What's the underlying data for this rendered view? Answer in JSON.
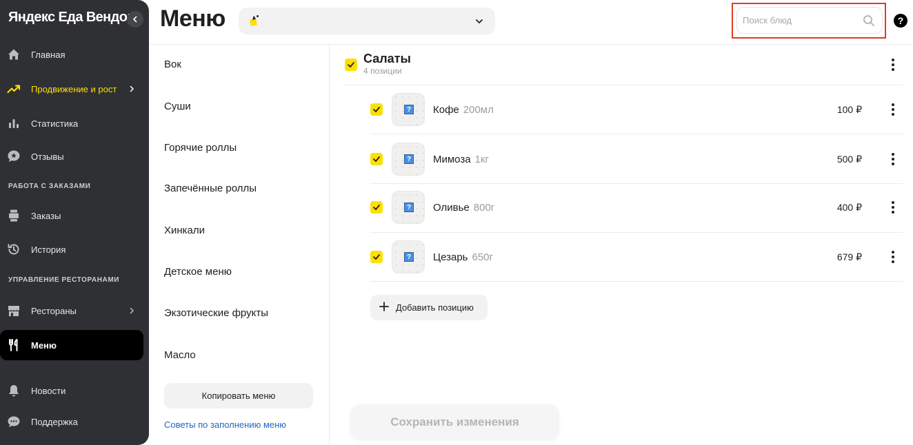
{
  "sidebar": {
    "brand": "Яндекс Еда Вендор",
    "items": [
      {
        "label": "Главная",
        "icon": "home-icon"
      },
      {
        "label": "Продвижение и рост",
        "icon": "trending-up-icon"
      },
      {
        "label": "Статистика",
        "icon": "bar-chart-icon"
      },
      {
        "label": "Отзывы",
        "icon": "review-star-icon"
      },
      {
        "label": "Заказы",
        "icon": "orders-icon"
      },
      {
        "label": "История",
        "icon": "history-icon"
      },
      {
        "label": "Рестораны",
        "icon": "store-icon"
      },
      {
        "label": "Меню",
        "icon": "fork-knife-icon"
      },
      {
        "label": "Новости",
        "icon": "bell-icon"
      },
      {
        "label": "Поддержка",
        "icon": "chat-icon"
      }
    ],
    "sections": {
      "orders": "РАБОТА С ЗАКАЗАМИ",
      "restaurants": "УПРАВЛЕНИЕ РЕСТОРАНАМИ"
    },
    "accent_color": "#fce000"
  },
  "header": {
    "title": "Меню",
    "search_placeholder": "Поиск блюд",
    "help": "?"
  },
  "categories": [
    "Вок",
    "Суши",
    "Горячие роллы",
    "Запечённые роллы",
    "Хинкали",
    "Детское меню",
    "Экзотические фрукты",
    "Масло"
  ],
  "left_panel": {
    "copy_menu_label": "Копировать меню",
    "tips_link": "Советы по заполнению меню"
  },
  "category": {
    "title": "Салаты",
    "count": "4 позиции",
    "checked": true
  },
  "items": [
    {
      "name": "Кофе",
      "weight": "200мл",
      "price": "100 ₽",
      "checked": true
    },
    {
      "name": "Мимоза",
      "weight": "1кг",
      "price": "500 ₽",
      "checked": true
    },
    {
      "name": "Оливье",
      "weight": "800г",
      "price": "400 ₽",
      "checked": true
    },
    {
      "name": "Цезарь",
      "weight": "650г",
      "price": "679 ₽",
      "checked": true
    }
  ],
  "actions": {
    "add_item": "Добавить позицию",
    "save": "Сохранить изменения"
  },
  "thumb_placeholder": "?"
}
